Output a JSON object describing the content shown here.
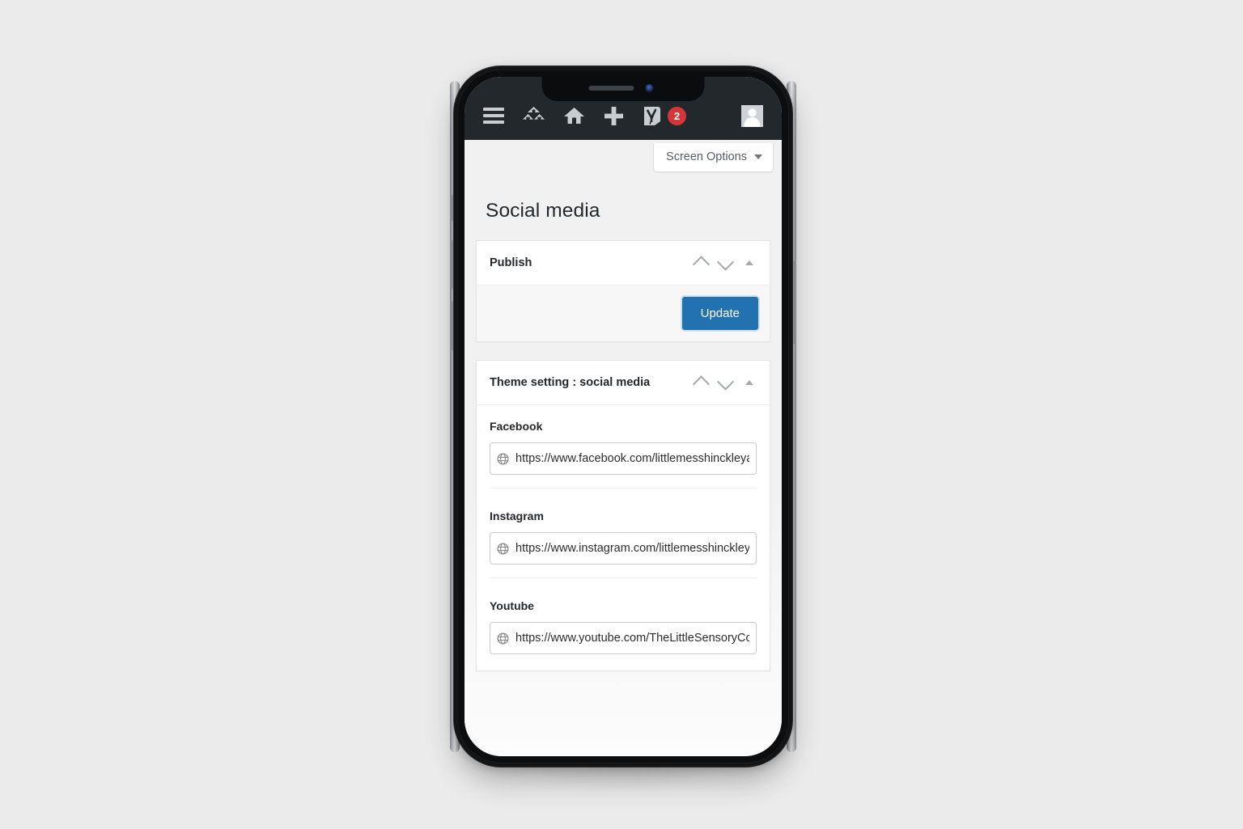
{
  "adminbar": {
    "menu_icon": "hamburger-menu-icon",
    "items": [
      {
        "icon": "multisite-network-icon",
        "label": ""
      },
      {
        "icon": "site-home-icon",
        "label": ""
      },
      {
        "icon": "new-content-plus-icon",
        "label": ""
      },
      {
        "icon": "yoast-seo-icon",
        "label": ""
      }
    ],
    "notification_count": "2",
    "avatar_icon": "user-avatar-icon",
    "background_color": "#23282d",
    "badge_color": "#d63638"
  },
  "screen_options": {
    "label": "Screen Options",
    "caret_icon": "caret-down-icon"
  },
  "page": {
    "title": "Social media"
  },
  "publish_box": {
    "title": "Publish",
    "move_up_icon": "chevron-up-icon",
    "move_down_icon": "chevron-down-icon",
    "toggle_icon": "triangle-up-icon",
    "update_label": "Update",
    "update_color": "#2271b1"
  },
  "theme_settings_box": {
    "title": "Theme setting : social media",
    "move_up_icon": "chevron-up-icon",
    "move_down_icon": "chevron-down-icon",
    "toggle_icon": "triangle-up-icon",
    "fields": [
      {
        "label": "Facebook",
        "icon": "globe-icon",
        "value": "https://www.facebook.com/littlemesshinckleyand",
        "placeholder": "https://"
      },
      {
        "label": "Instagram",
        "icon": "globe-icon",
        "value": "https://www.instagram.com/littlemesshinckleyand",
        "placeholder": "https://"
      },
      {
        "label": "Youtube",
        "icon": "globe-icon",
        "value": "https://www.youtube.com/TheLittleSensoryCo/",
        "placeholder": "https://"
      }
    ]
  },
  "device": {
    "speaker_icon": "earpiece-speaker-icon",
    "camera_icon": "front-camera-icon",
    "volume_up_icon": "volume-up-button",
    "volume_down_icon": "volume-down-button",
    "silent_switch_icon": "ring-silent-switch",
    "power_icon": "power-button"
  }
}
